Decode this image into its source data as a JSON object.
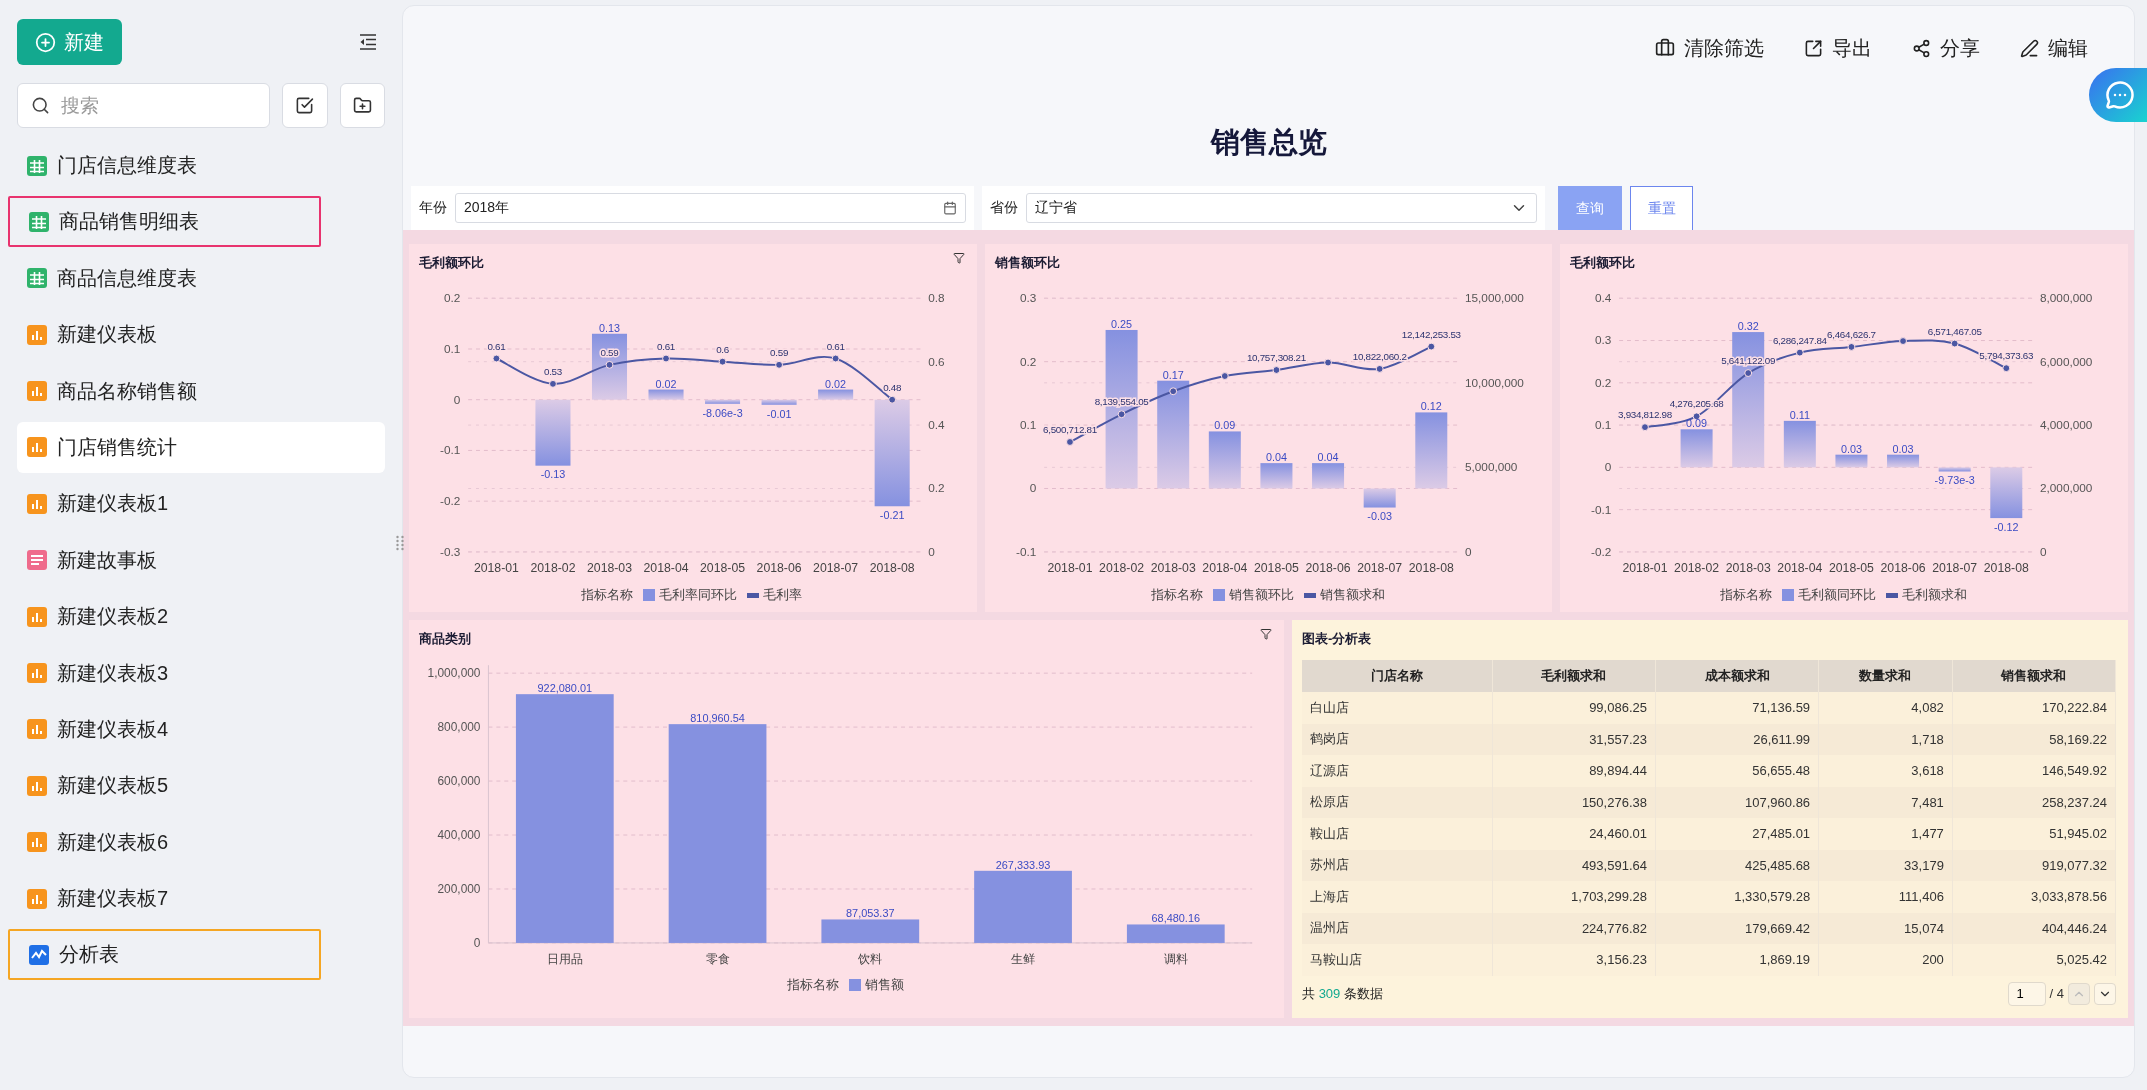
{
  "sidebar": {
    "new_button": "新建",
    "search": {
      "placeholder": "搜索"
    },
    "items": [
      {
        "label": "门店信息维度表",
        "kind": "table",
        "selected": false
      },
      {
        "label": "商品销售明细表",
        "kind": "table",
        "selected": false,
        "color": "#e8336e"
      },
      {
        "label": "商品信息维度表",
        "kind": "table",
        "selected": false
      },
      {
        "label": "新建仪表板",
        "kind": "dashboard",
        "selected": false
      },
      {
        "label": "商品名称销售额",
        "kind": "dashboard",
        "selected": false
      },
      {
        "label": "门店销售统计",
        "kind": "dashboard",
        "selected": true
      },
      {
        "label": "新建仪表板1",
        "kind": "dashboard",
        "selected": false
      },
      {
        "label": "新建故事板",
        "kind": "story",
        "selected": false
      },
      {
        "label": "新建仪表板2",
        "kind": "dashboard",
        "selected": false
      },
      {
        "label": "新建仪表板3",
        "kind": "dashboard",
        "selected": false
      },
      {
        "label": "新建仪表板4",
        "kind": "dashboard",
        "selected": false
      },
      {
        "label": "新建仪表板5",
        "kind": "dashboard",
        "selected": false
      },
      {
        "label": "新建仪表板6",
        "kind": "dashboard",
        "selected": false
      },
      {
        "label": "新建仪表板7",
        "kind": "dashboard",
        "selected": false
      },
      {
        "label": "分析表",
        "kind": "analysis",
        "selected": false,
        "color": "#f5a623"
      }
    ]
  },
  "toolbar": [
    {
      "label": "清除筛选",
      "kind": "clear"
    },
    {
      "label": "导出",
      "kind": "export"
    },
    {
      "label": "分享",
      "kind": "share"
    },
    {
      "label": "编辑",
      "kind": "edit"
    }
  ],
  "title": "销售总览",
  "filters": [
    {
      "label": "年份",
      "value": "2018年",
      "kind": "date"
    },
    {
      "label": "省份",
      "value": "辽宁省",
      "kind": "select"
    }
  ],
  "actions": {
    "query": "查询",
    "reset": "重置"
  },
  "charts": [
    {
      "title": "毛利额环比",
      "filter_icon": true,
      "legend_title": "指标名称",
      "chart_data": {
        "type": "bar",
        "grid": true,
        "categories": [
          "2018-01",
          "2018-02",
          "2018-03",
          "2018-04",
          "2018-05",
          "2018-06",
          "2018-07",
          "2018-08"
        ],
        "ylim": [
          -0.3,
          0.2
        ],
        "yticks": [
          -0.3,
          -0.2,
          -0.1,
          0,
          0.1,
          0.2
        ],
        "y2lim": [
          0,
          0.8
        ],
        "y2ticks": [
          0,
          0.2,
          0.4,
          0.6,
          0.8
        ],
        "series": [
          {
            "name": "毛利率同环比",
            "color": "#8591e0",
            "values": [
              null,
              -0.13,
              0.13,
              0.02,
              -0.00806,
              -0.01,
              0.02,
              -0.21
            ],
            "value_labels": [
              null,
              "-0.13",
              "0.13",
              "0.02",
              "-8.06e-3",
              "-0.01",
              "0.02",
              "-0.21"
            ]
          },
          {
            "name": "毛利率",
            "type": "line",
            "axis": "y2",
            "marker": true,
            "color": "#4b57a3",
            "values": [
              0.61,
              0.53,
              0.59,
              0.61,
              0.6,
              0.59,
              0.61,
              0.48
            ],
            "value_labels": [
              "0.61",
              "0.53",
              "0.59",
              "0.61",
              "0.6",
              "0.59",
              "0.61",
              "0.48"
            ]
          }
        ]
      }
    },
    {
      "title": "销售额环比",
      "filter_icon": false,
      "legend_title": "指标名称",
      "chart_data": {
        "type": "bar",
        "grid": true,
        "categories": [
          "2018-01",
          "2018-02",
          "2018-03",
          "2018-04",
          "2018-05",
          "2018-06",
          "2018-07",
          "2018-08"
        ],
        "ylim": [
          -0.1,
          0.3
        ],
        "yticks": [
          -0.1,
          0,
          0.1,
          0.2,
          0.3
        ],
        "y2lim": [
          0,
          15000000
        ],
        "y2ticks": [
          {
            "value": 0,
            "label": "0"
          },
          {
            "value": 5000000,
            "label": "5,000,000"
          },
          {
            "value": 10000000,
            "label": "10,000,000"
          },
          {
            "value": 15000000,
            "label": "15,000,000"
          }
        ],
        "series": [
          {
            "name": "销售额环比",
            "color": "#8591e0",
            "values": [
              null,
              0.25,
              0.17,
              0.09,
              0.04,
              0.04,
              -0.03,
              0.12
            ],
            "value_labels": [
              null,
              "0.25",
              "0.17",
              "0.09",
              "0.04",
              "0.04",
              "-0.03",
              "0.12"
            ]
          },
          {
            "name": "销售额求和",
            "type": "line",
            "axis": "y2",
            "marker": true,
            "color": "#4b57a3",
            "values": [
              6500712.81,
              8139554.05,
              9500000,
              10400000,
              10757308.21,
              11200000,
              10822060.2,
              12142253.53
            ],
            "value_labels": [
              "6,500,712.81",
              "8,139,554.05",
              null,
              null,
              "10,757,308.21",
              null,
              "10,822,060.2",
              "12,142,253.53"
            ]
          }
        ]
      }
    },
    {
      "title": "毛利额环比",
      "filter_icon": false,
      "legend_title": "指标名称",
      "chart_data": {
        "type": "bar",
        "grid": true,
        "categories": [
          "2018-01",
          "2018-02",
          "2018-03",
          "2018-04",
          "2018-05",
          "2018-06",
          "2018-07",
          "2018-08"
        ],
        "ylim": [
          -0.2,
          0.4
        ],
        "yticks": [
          -0.2,
          -0.1,
          0,
          0.1,
          0.2,
          0.3,
          0.4
        ],
        "y2lim": [
          0,
          8000000
        ],
        "y2ticks": [
          {
            "value": 0,
            "label": "0"
          },
          {
            "value": 2000000,
            "label": "2,000,000"
          },
          {
            "value": 4000000,
            "label": "4,000,000"
          },
          {
            "value": 6000000,
            "label": "6,000,000"
          },
          {
            "value": 8000000,
            "label": "8,000,000"
          }
        ],
        "series": [
          {
            "name": "毛利额同环比",
            "color": "#8591e0",
            "values": [
              null,
              0.09,
              0.32,
              0.11,
              0.03,
              0.03,
              -0.00973,
              -0.12
            ],
            "value_labels": [
              null,
              "0.09",
              "0.32",
              "0.11",
              "0.03",
              "0.03",
              "-9.73e-3",
              "-0.12"
            ]
          },
          {
            "name": "毛利额求和",
            "type": "line",
            "axis": "y2",
            "marker": true,
            "color": "#4b57a3",
            "values": [
              3934812.98,
              4276205.68,
              5641122.09,
              6286247.84,
              6464626.7,
              6650000,
              6571467.05,
              5794373.63
            ],
            "value_labels": [
              "3,934,812.98",
              "4,276,205.68",
              "5,641,122.09",
              "6,286,247.84",
              "6,464,626.7",
              null,
              "6,571,467.05",
              "5,794,373.63"
            ]
          }
        ]
      }
    }
  ],
  "category_chart": {
    "title": "商品类别",
    "filter_icon": true,
    "legend_title": "指标名称",
    "chart_data": {
      "type": "bar",
      "grid": true,
      "categories": [
        "日用品",
        "零食",
        "饮料",
        "生鲜",
        "调料"
      ],
      "ylim": [
        0,
        1000000
      ],
      "yticks": [
        {
          "value": 0,
          "label": "0"
        },
        {
          "value": 200000,
          "label": "200,000"
        },
        {
          "value": 400000,
          "label": "400,000"
        },
        {
          "value": 600000,
          "label": "600,000"
        },
        {
          "value": 800000,
          "label": "800,000"
        },
        {
          "value": 1000000,
          "label": "1,000,000"
        }
      ],
      "series": [
        {
          "name": "销售额",
          "color": "#8591e0",
          "values": [
            922080.01,
            810960.54,
            87053.37,
            267333.93,
            68480.16
          ],
          "value_labels": [
            "922,080.01",
            "810,960.54",
            "87,053.37",
            "267,333.93",
            "68,480.16"
          ]
        }
      ]
    }
  },
  "table": {
    "title": "图表-分析表",
    "columns": [
      "门店名称",
      "毛利额求和",
      "成本额求和",
      "数量求和",
      "销售额求和"
    ],
    "rows": [
      [
        "白山店",
        "99,086.25",
        "71,136.59",
        "4,082",
        "170,222.84"
      ],
      [
        "鹤岗店",
        "31,557.23",
        "26,611.99",
        "1,718",
        "58,169.22"
      ],
      [
        "辽源店",
        "89,894.44",
        "56,655.48",
        "3,618",
        "146,549.92"
      ],
      [
        "松原店",
        "150,276.38",
        "107,960.86",
        "7,481",
        "258,237.24"
      ],
      [
        "鞍山店",
        "24,460.01",
        "27,485.01",
        "1,477",
        "51,945.02"
      ],
      [
        "苏州店",
        "493,591.64",
        "425,485.68",
        "33,179",
        "919,077.32"
      ],
      [
        "上海店",
        "1,703,299.28",
        "1,330,579.28",
        "111,406",
        "3,033,878.56"
      ],
      [
        "温州店",
        "224,776.82",
        "179,669.42",
        "15,074",
        "404,446.24"
      ],
      [
        "马鞍山店",
        "3,156.23",
        "1,869.19",
        "200",
        "5,025.42"
      ]
    ],
    "footer": {
      "prefix": "共",
      "count": "309",
      "suffix": "条数据"
    },
    "page": "1",
    "pages": "/ 4"
  }
}
